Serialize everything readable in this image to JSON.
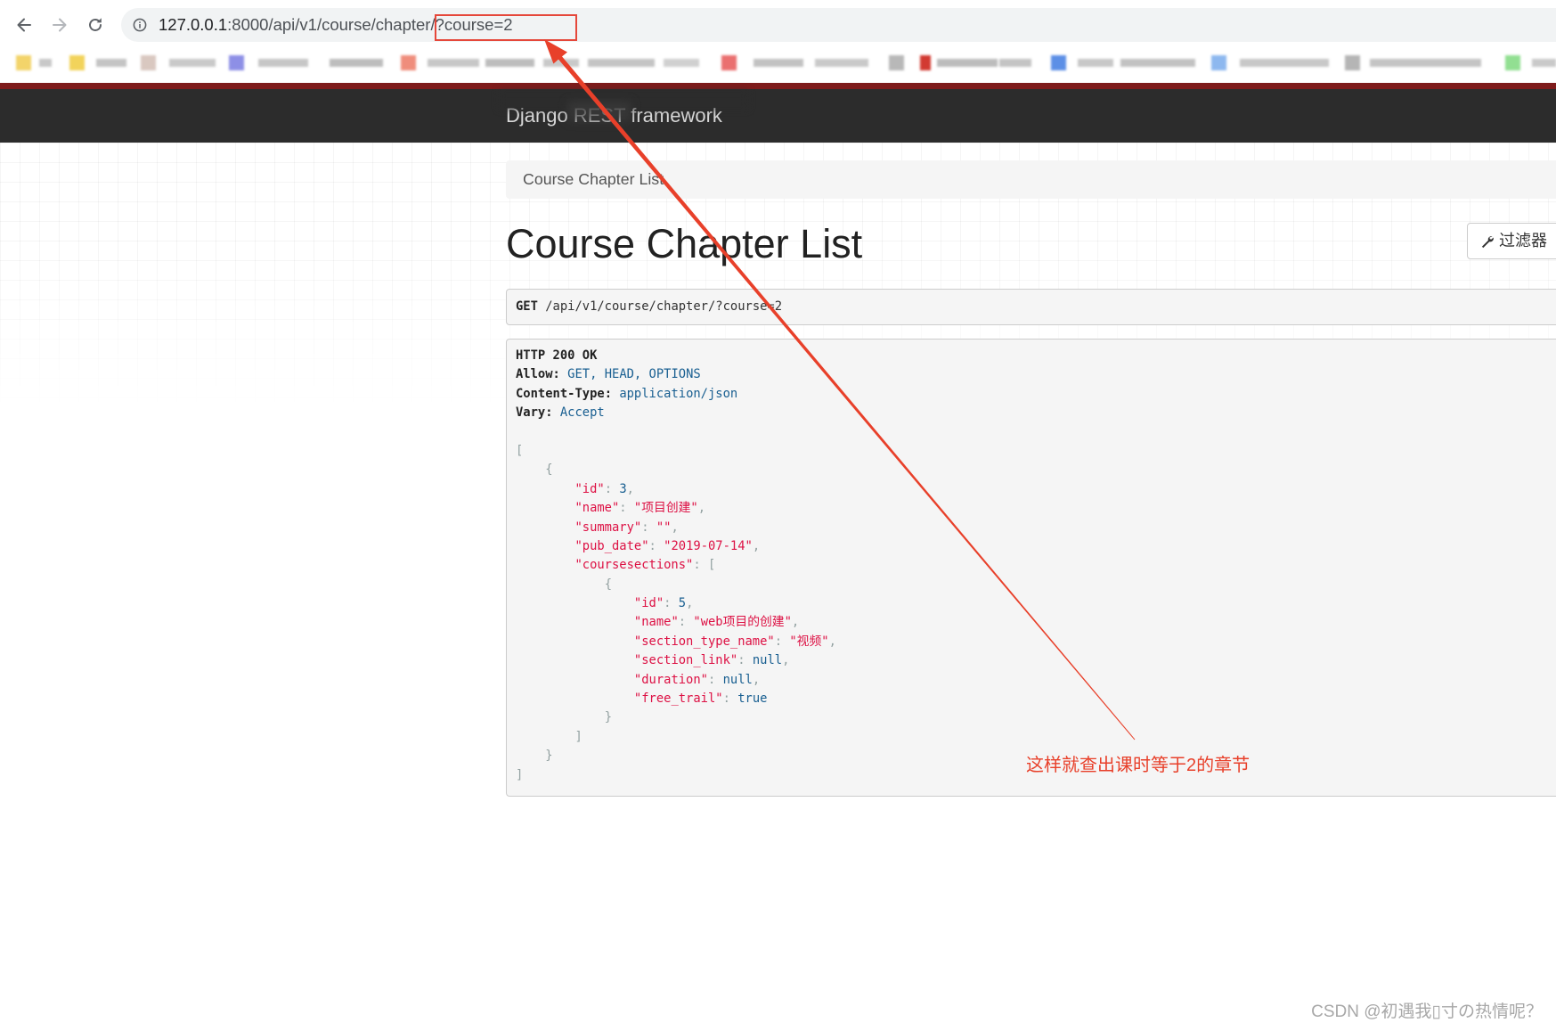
{
  "browser": {
    "url_host": "127.0.0.1",
    "url_path": ":8000/api/v1/course/chapter/",
    "url_query": "?course=2",
    "icons": {
      "back": "arrow-left-icon",
      "forward": "arrow-right-icon",
      "reload": "reload-icon",
      "site_info": "info-icon"
    }
  },
  "navbar": {
    "brand": "Django REST framework"
  },
  "breadcrumb": [
    "Course Chapter List"
  ],
  "page": {
    "title": "Course Chapter List",
    "filter_button": "过滤器",
    "filter_icon": "wrench-icon"
  },
  "request": {
    "method": "GET",
    "path": "/api/v1/course/chapter/?course=2"
  },
  "response": {
    "status": "HTTP 200 OK",
    "headers": [
      {
        "name": "Allow",
        "value": "GET, HEAD, OPTIONS"
      },
      {
        "name": "Content-Type",
        "value": "application/json"
      },
      {
        "name": "Vary",
        "value": "Accept"
      }
    ],
    "body": [
      {
        "id": 3,
        "name": "项目创建",
        "summary": "",
        "pub_date": "2019-07-14",
        "coursesections": [
          {
            "id": 5,
            "name": "web项目的创建",
            "section_type_name": "视频",
            "section_link": null,
            "duration": null,
            "free_trail": true
          }
        ]
      }
    ]
  },
  "annotation": {
    "text": "这样就查出课时等于2的章节",
    "color": "#e8402a"
  },
  "watermark": "CSDN @初遇我▯寸の热情呢？",
  "colors": {
    "navbar_bg": "#2c2c2c",
    "navbar_border": "#7e1b1b",
    "json_string": "#dd1144",
    "json_literal": "#195f91",
    "json_punctuation": "#93a1a1",
    "highlight_box": "#e5473a"
  }
}
